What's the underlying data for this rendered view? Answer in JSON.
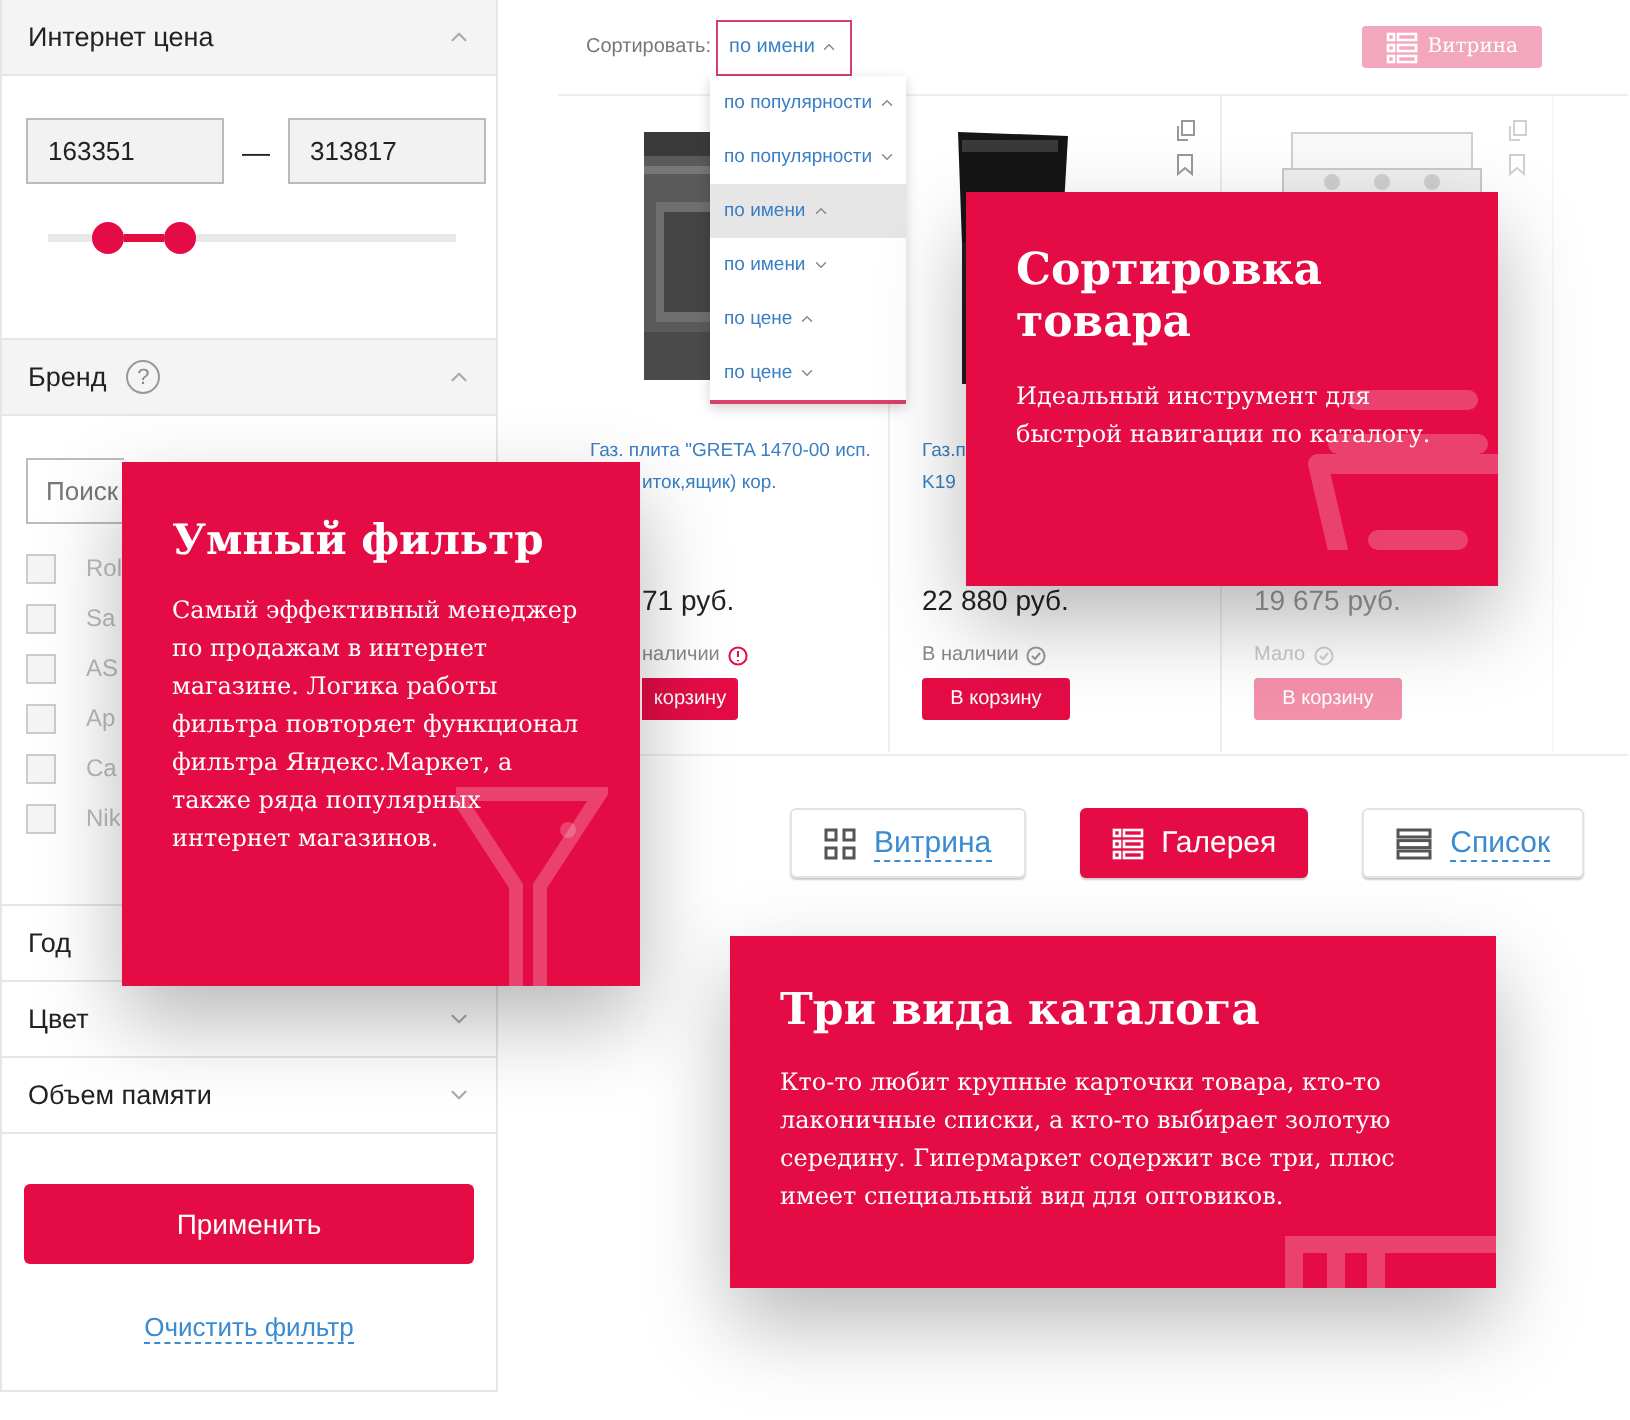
{
  "filter": {
    "sections": [
      {
        "kind": "price",
        "title": "Интернет цена",
        "expanded": true,
        "min": "163351",
        "max": "313817",
        "separator": "—",
        "thumbs": [
          {
            "level": 0.147
          },
          {
            "level": 0.324
          }
        ]
      },
      {
        "kind": "brand",
        "title": "Бренд",
        "help": "?",
        "expanded": true,
        "search": {
          "placeholder": "Поиск"
        },
        "options": [
          {
            "label": "Rol",
            "checked": false
          },
          {
            "label": "Sa",
            "checked": false
          },
          {
            "label": "AS",
            "checked": false
          },
          {
            "label": "Ap",
            "checked": false
          },
          {
            "label": "Ca",
            "checked": false
          },
          {
            "label": "Nik",
            "checked": false
          }
        ]
      },
      {
        "kind": "plain",
        "title": "Год"
      },
      {
        "kind": "plain",
        "title": "Цвет",
        "expanded": false
      },
      {
        "kind": "plain",
        "title": "Объем памяти",
        "expanded": false
      }
    ],
    "apply": "Применить",
    "clear": "Очистить фильтр"
  },
  "catalog": {
    "sort_label": "Сортировать:",
    "sort_value": {
      "label": "по имени",
      "ascending": true
    },
    "sort_menu": [
      {
        "label": "по популярности",
        "ascending": true,
        "selected": false
      },
      {
        "label": "по популярности",
        "ascending": false,
        "selected": false
      },
      {
        "label": "по имени",
        "ascending": true,
        "selected": true
      },
      {
        "label": "по имени",
        "ascending": false,
        "selected": false
      },
      {
        "label": "по цене",
        "ascending": true,
        "selected": false
      },
      {
        "label": "по цене",
        "ascending": false,
        "selected": false
      }
    ],
    "view_button": "Витрина",
    "products": [
      {
        "title_lines": [
          "Газ. плита \"GRETA 1470-00 исп.",
          "иток,ящик) кор."
        ],
        "price": "71 руб.",
        "stock": "наличии",
        "warning": true,
        "cart": "корзину",
        "clipped": true,
        "faded": false
      },
      {
        "title_lines": [
          "Газ.п",
          "K19"
        ],
        "price": "22 880 руб.",
        "stock": "В наличии",
        "warning": false,
        "cart": "В корзину",
        "clipped": false,
        "faded": false
      },
      {
        "price": "19 675 руб.",
        "stock": "Мало",
        "warning": false,
        "cart": "В корзину",
        "clipped": false,
        "faded": true
      }
    ]
  },
  "views": [
    {
      "label": "Витрина",
      "kind": "grid",
      "selected": false
    },
    {
      "label": "Галерея",
      "kind": "gallery",
      "selected": true
    },
    {
      "label": "Список",
      "kind": "list",
      "selected": false
    }
  ],
  "promos": [
    {
      "title": "Умный фильтр",
      "text": "Самый эффективный менеджер по продажам в интернет магазине. Логика работы фильтра повторяет функционал фильтра Яндекс.Маркет, а также ряда популярных интернет магазинов.",
      "kind": "glass"
    },
    {
      "title": "Сортировка товара",
      "text": "Идеальный инструмент для быстрой навигации по каталогу.",
      "kind": "cart"
    },
    {
      "title": "Три вида каталога",
      "text": "Кто-то любит крупные карточки товара, кто-то лаконичные списки, а кто-то выбирает золотую середину. Гипермаркет содержит все три, плюс имеет специальный вид для оптовиков.",
      "kind": "lines"
    }
  ]
}
